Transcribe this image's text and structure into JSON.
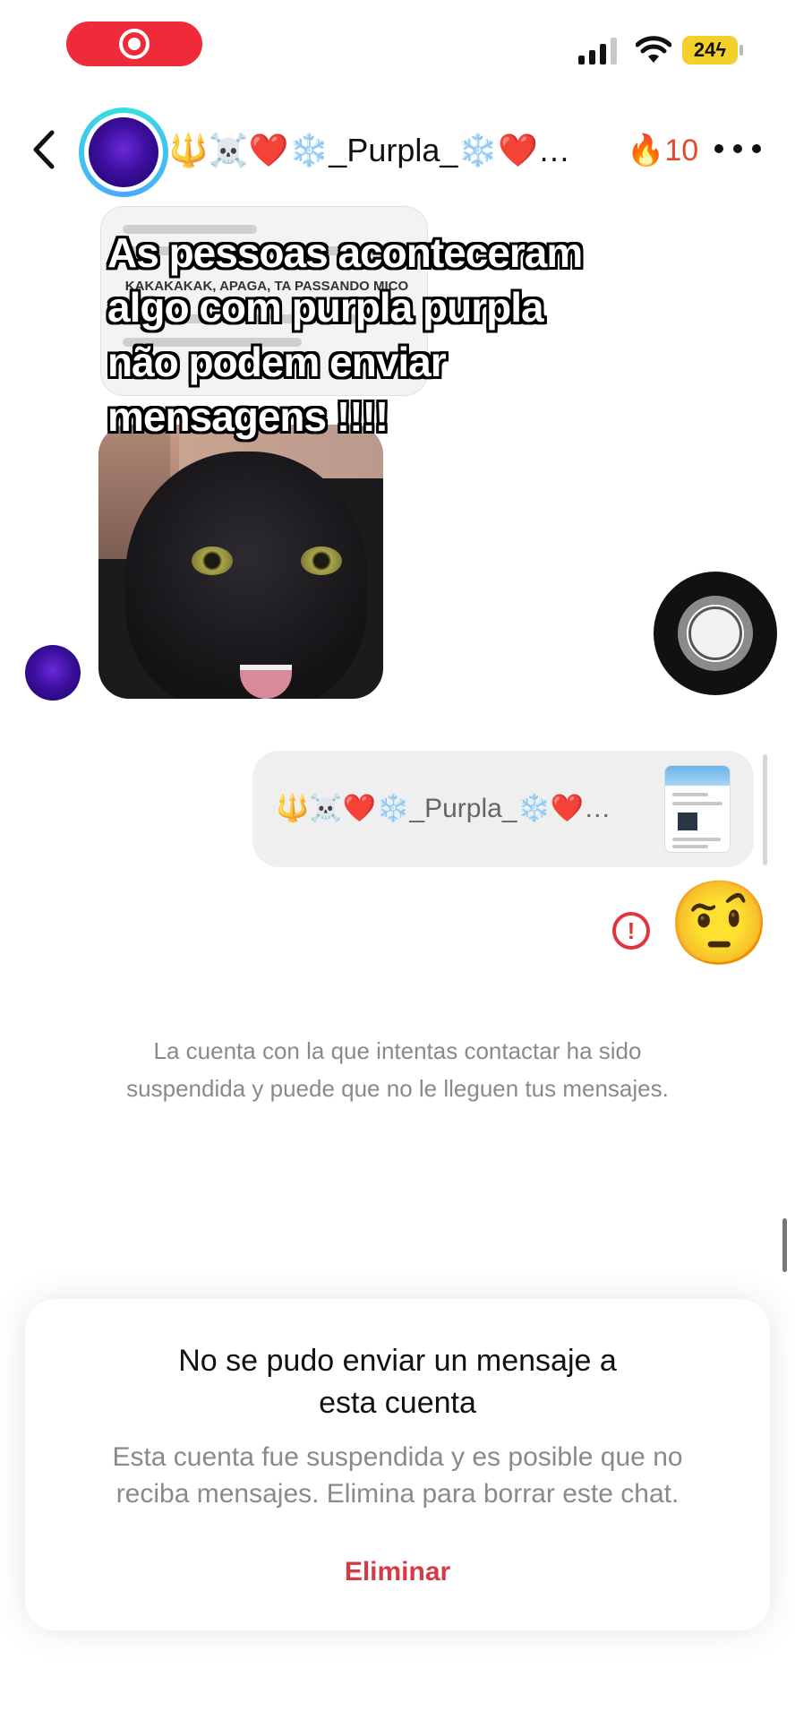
{
  "header": {
    "name": "🔱☠️❤️❄️_Purpla_❄️❤️…",
    "streak": "🔥10"
  },
  "status_bar": {
    "battery": "24"
  },
  "messages": {
    "quoted_screenshot_caption": "KAKAKAKAK, APAGA, TA PASSANDO MICO",
    "overlay_caption_lines": [
      "As pessoas aconteceram",
      "algo com purpla purpla",
      "não podem enviar",
      "mensagens !!!!"
    ],
    "shared_profile_name": "🔱☠️❤️❄️_Purpla_❄️❤️…",
    "emoji_reply": "🤨",
    "error_mark": "!"
  },
  "notice": {
    "suspended_line1": "La cuenta con la que intentas contactar ha sido",
    "suspended_line2": "suspendida y puede que no le lleguen tus mensajes."
  },
  "dialog": {
    "title_line1": "No se pudo enviar un mensaje a",
    "title_line2": "esta cuenta",
    "body_line1": "Esta cuenta fue suspendida y es posible que no",
    "body_line2": "reciba mensajes. Elimina para borrar este chat.",
    "button": "Eliminar"
  },
  "colors": {
    "accent_red": "#d63a44",
    "record_pill": "#ef2b3a",
    "streak": "#e8462a",
    "battery": "#f4d02a"
  },
  "icons": {
    "back": "chevron-left-icon",
    "more": "ellipsis-icon",
    "record": "record-icon",
    "signal": "cellular-signal-icon",
    "wifi": "wifi-icon",
    "error": "error-icon"
  }
}
